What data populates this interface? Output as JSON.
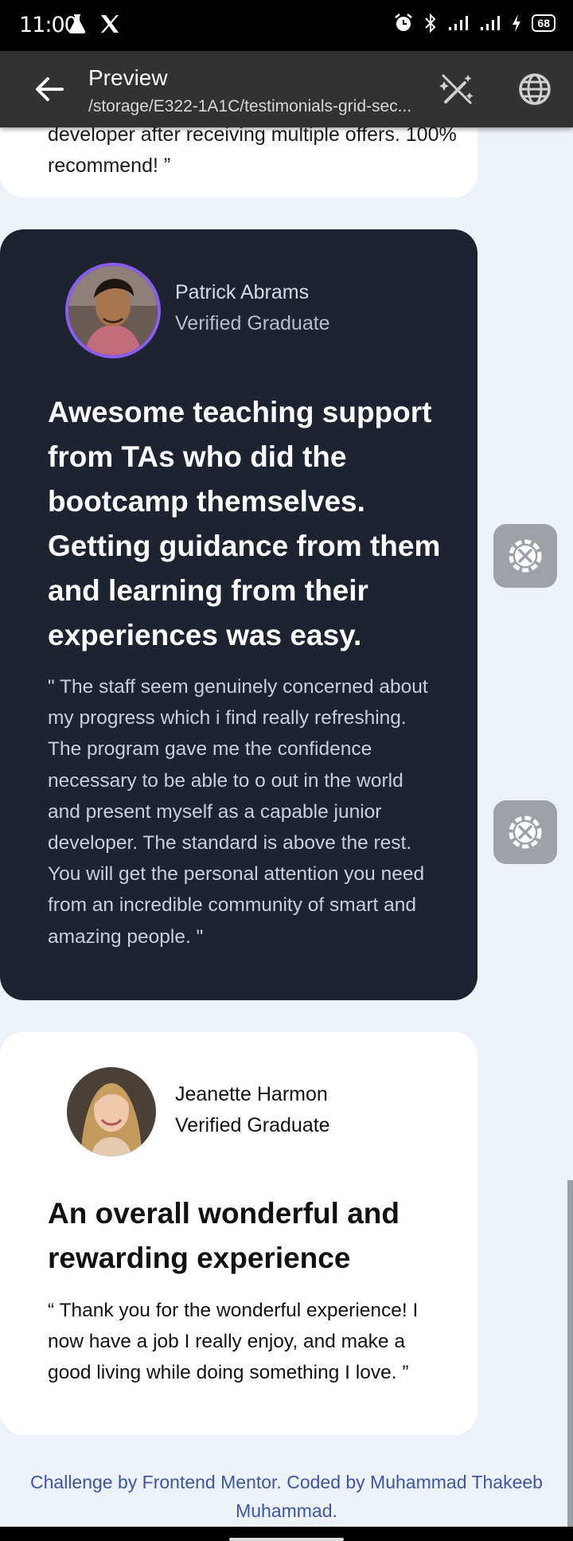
{
  "status_bar": {
    "time": "11:00",
    "battery": "68",
    "icons": [
      "beaker-icon",
      "x-logo-icon",
      "alarm-icon",
      "bluetooth-icon",
      "signal-icon",
      "signal-icon",
      "charging-icon",
      "battery-icon"
    ]
  },
  "app_bar": {
    "title": "Preview",
    "subtitle": "/storage/E322-1A1C/testimonials-grid-sec...",
    "back_icon": "arrow-left-icon",
    "actions": [
      "magic-wand-icon",
      "globe-icon"
    ]
  },
  "cards": {
    "top": {
      "quote_end": "developer after receiving multiple offers. 100% recommend! ”"
    },
    "patrick": {
      "name": "Patrick Abrams",
      "subtitle": "Verified Graduate",
      "headline": "Awesome teaching support from TAs who did the bootcamp themselves. Getting guidance from them and learning from their experiences was easy.",
      "quote": "\" The staff seem genuinely concerned about my progress which i find really refreshing. The program gave me the confidence necessary to be able to o out in the world and present myself as a capable junior developer. The standard is above the rest. You will get the personal attention you need from an incredible community of smart and amazing people. \"",
      "accent": "#8b5cf6",
      "background": "#1d2331"
    },
    "jeanette": {
      "name": "Jeanette Harmon",
      "subtitle": "Verified Graduate",
      "headline": "An overall wonderful and rewarding experience",
      "quote": "“ Thank you for the wonderful experience! I now have a job I really enjoy, and make a good living while doing something I love. ”"
    }
  },
  "side_tools": [
    "tools-gear-icon",
    "tools-gear-icon"
  ],
  "attribution": "Challenge by Frontend Mentor. Coded by Muhammad Thakeeb Muhammad."
}
